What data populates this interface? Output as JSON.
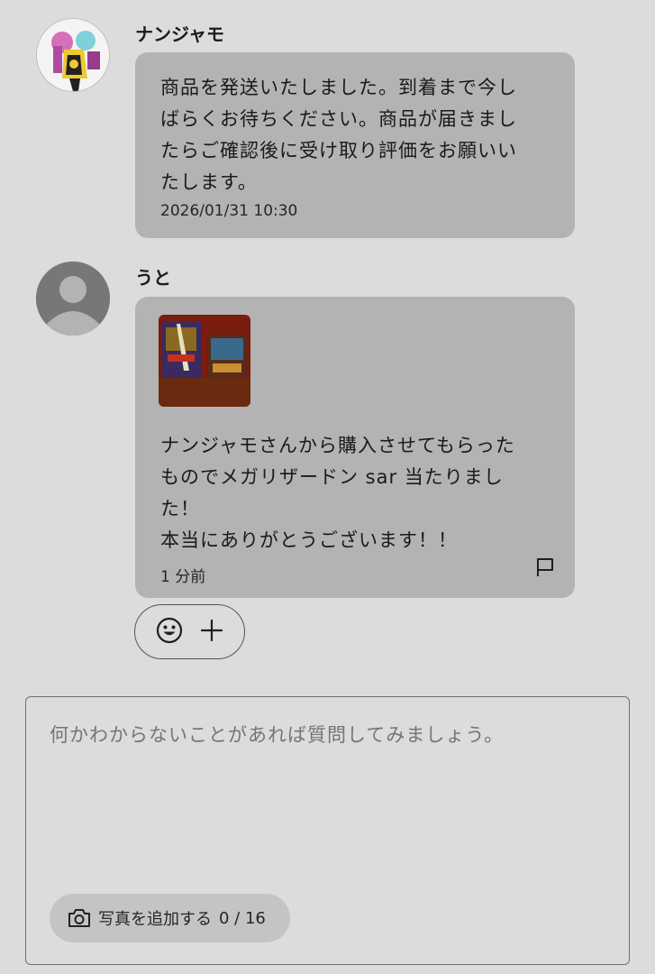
{
  "messages": [
    {
      "sender": "ナンジャモ",
      "text": "商品を発送いたしました。到着まで今し\nばらくお待ちください。商品が届きまし\nたらご確認後に受け取り評価をお願いい\nたします。",
      "timestamp": "2026/01/31 10:30"
    },
    {
      "sender": "うと",
      "text": "ナンジャモさんから購入させてもらった\nものでメガリザードン sar 当たりまし\nた！\n本当にありがとうございます！！",
      "timestamp": "1 分前"
    }
  ],
  "composer": {
    "placeholder": "何かわからないことがあれば質問してみましょう。",
    "add_photo_label": "写真を追加する",
    "photo_count": "0 / 16"
  },
  "icons": {
    "flag": "flag-icon",
    "emoji": "smile-emoji-icon",
    "add": "plus-icon",
    "camera": "camera-icon"
  }
}
